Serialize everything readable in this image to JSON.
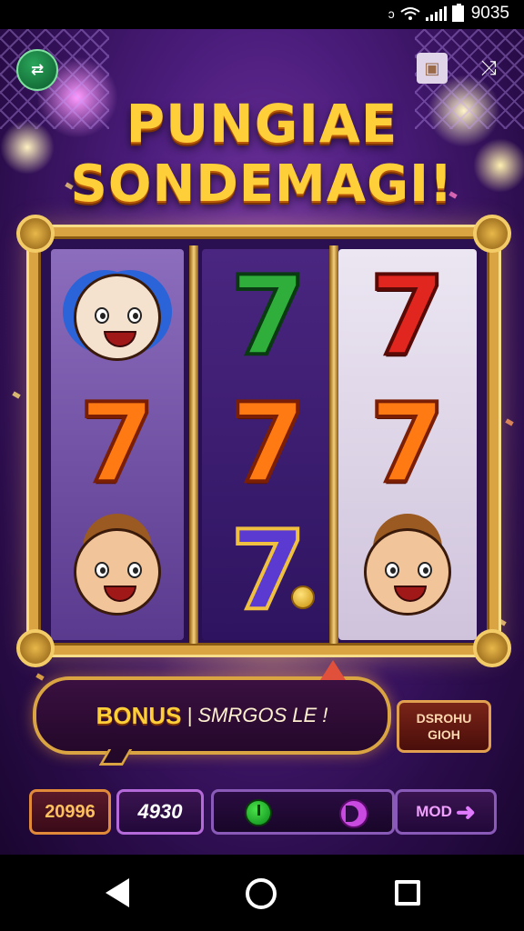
{
  "status_bar": {
    "time": "9035",
    "icons": [
      "nfc-icon",
      "wifi-icon",
      "signal-icon",
      "battery-icon"
    ]
  },
  "header": {
    "menu_icon_label": "⇄",
    "title_line1": "PUNGIAE",
    "title_line2": "SONDEMAGI!"
  },
  "reels": [
    {
      "symbols": [
        "clown",
        "7",
        "boy"
      ]
    },
    {
      "symbols": [
        "7",
        "7",
        "7"
      ]
    },
    {
      "symbols": [
        "7",
        "7",
        "boy"
      ]
    }
  ],
  "bonus": {
    "word": "BONUS",
    "rest": "| SMRGOS LE !"
  },
  "side_button": {
    "line1": "DSROHU",
    "line2": "GIOH"
  },
  "bottom": {
    "credits": "20996",
    "bet": "4930",
    "mode_label": "MOD"
  },
  "colors": {
    "gold": "#d9a441",
    "title": "#ffcf3a",
    "background": "#4a1c7a"
  }
}
